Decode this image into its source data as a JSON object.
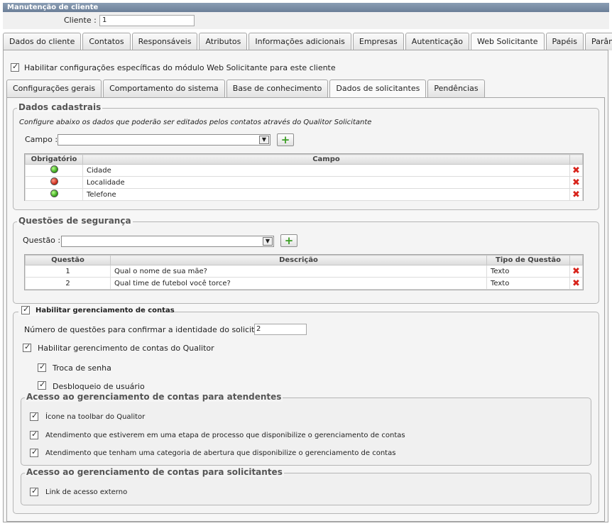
{
  "window": {
    "title": "Manutenção de cliente"
  },
  "client": {
    "label": "Cliente :",
    "value": "1"
  },
  "main_tabs": [
    {
      "label": "Dados do cliente"
    },
    {
      "label": "Contatos"
    },
    {
      "label": "Responsáveis"
    },
    {
      "label": "Atributos"
    },
    {
      "label": "Informações adicionais"
    },
    {
      "label": "Empresas"
    },
    {
      "label": "Autenticação"
    },
    {
      "label": "Web Solicitante"
    },
    {
      "label": "Papéis"
    },
    {
      "label": "Parâmetros"
    }
  ],
  "enable_specific": {
    "label": "Habilitar configurações específicas do módulo Web Solicitante para este cliente",
    "checked": true
  },
  "sub_tabs": [
    {
      "label": "Configurações gerais"
    },
    {
      "label": "Comportamento do sistema"
    },
    {
      "label": "Base de conhecimento"
    },
    {
      "label": "Dados de solicitantes"
    },
    {
      "label": "Pendências"
    }
  ],
  "dados_cadastrais": {
    "title": "Dados cadastrais",
    "description": "Configure abaixo os dados que poderão ser editados pelos contatos através do Qualitor Solicitante",
    "campo_label": "Campo :",
    "columns": [
      "Obrigatório",
      "Campo"
    ],
    "rows": [
      {
        "status": "green",
        "campo": "Cidade"
      },
      {
        "status": "red",
        "campo": "Localidade"
      },
      {
        "status": "green",
        "campo": "Telefone"
      }
    ]
  },
  "questoes": {
    "title": "Questões de segurança",
    "questao_label": "Questão :",
    "columns": [
      "Questão",
      "Descrição",
      "Tipo de Questão"
    ],
    "rows": [
      {
        "num": "1",
        "descricao": "Qual o nome de sua mãe?",
        "tipo": "Texto"
      },
      {
        "num": "2",
        "descricao": "Qual time de futebol você torce?",
        "tipo": "Texto"
      }
    ]
  },
  "gerenciamento": {
    "enable_label": "Habilitar gerenciamento de contas",
    "num_questions_label": "Número de questões para confirmar a identidade do solicitante :",
    "num_questions_value": "2",
    "qualitor_label": "Habilitar gerencimento de contas do Qualitor",
    "troca_senha": "Troca de senha",
    "desbloqueio": "Desbloqueio de usuário",
    "atendentes": {
      "title": "Acesso ao gerenciamento de contas para atendentes",
      "items": [
        "Ícone na toolbar do Qualitor",
        "Atendimento que estiverem em uma etapa de processo que disponibilize o gerenciamento de contas",
        "Atendimento que tenham uma categoria de abertura que disponibilize o gerenciamento de contas"
      ]
    },
    "solicitantes": {
      "title": "Acesso ao gerenciamento de contas para solicitantes",
      "items": [
        "Link de acesso externo"
      ]
    }
  },
  "icons": {
    "add": "+",
    "delete": "✖",
    "dropdown": "▼",
    "check": "✓"
  }
}
